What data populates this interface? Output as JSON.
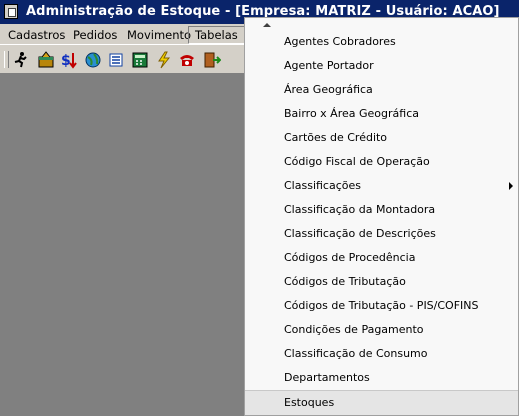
{
  "window": {
    "title": "Administração de Estoque - [Empresa: MATRIZ - Usuário: ACAO]"
  },
  "menubar": {
    "items": [
      {
        "label": "Cadastros"
      },
      {
        "label": "Pedidos"
      },
      {
        "label": "Movimento"
      },
      {
        "label": "Tabelas"
      }
    ]
  },
  "toolbar": {
    "icons": [
      "runner-icon",
      "package-icon",
      "dollar-transfer-icon",
      "globe-icon",
      "list-icon",
      "calculator-icon",
      "lightning-icon",
      "telephone-icon",
      "exit-door-icon"
    ]
  },
  "dropdown": {
    "items": [
      {
        "label": "Agentes Cobradores"
      },
      {
        "label": "Agente Portador"
      },
      {
        "label": "Área Geográfica"
      },
      {
        "label": "Bairro x Área Geográfica"
      },
      {
        "label": "Cartões de Crédito"
      },
      {
        "label": "Código Fiscal de Operação"
      },
      {
        "label": "Classificações",
        "submenu": true
      },
      {
        "label": "Classificação da Montadora"
      },
      {
        "label": "Classificação de Descrições"
      },
      {
        "label": "Códigos de Procedência"
      },
      {
        "label": "Códigos de Tributação"
      },
      {
        "label": "Códigos de Tributação - PIS/COFINS"
      },
      {
        "label": "Condições de Pagamento"
      },
      {
        "label": "Classificação de Consumo"
      },
      {
        "label": "Departamentos"
      },
      {
        "label": "Estoques",
        "highlighted": true
      }
    ]
  }
}
